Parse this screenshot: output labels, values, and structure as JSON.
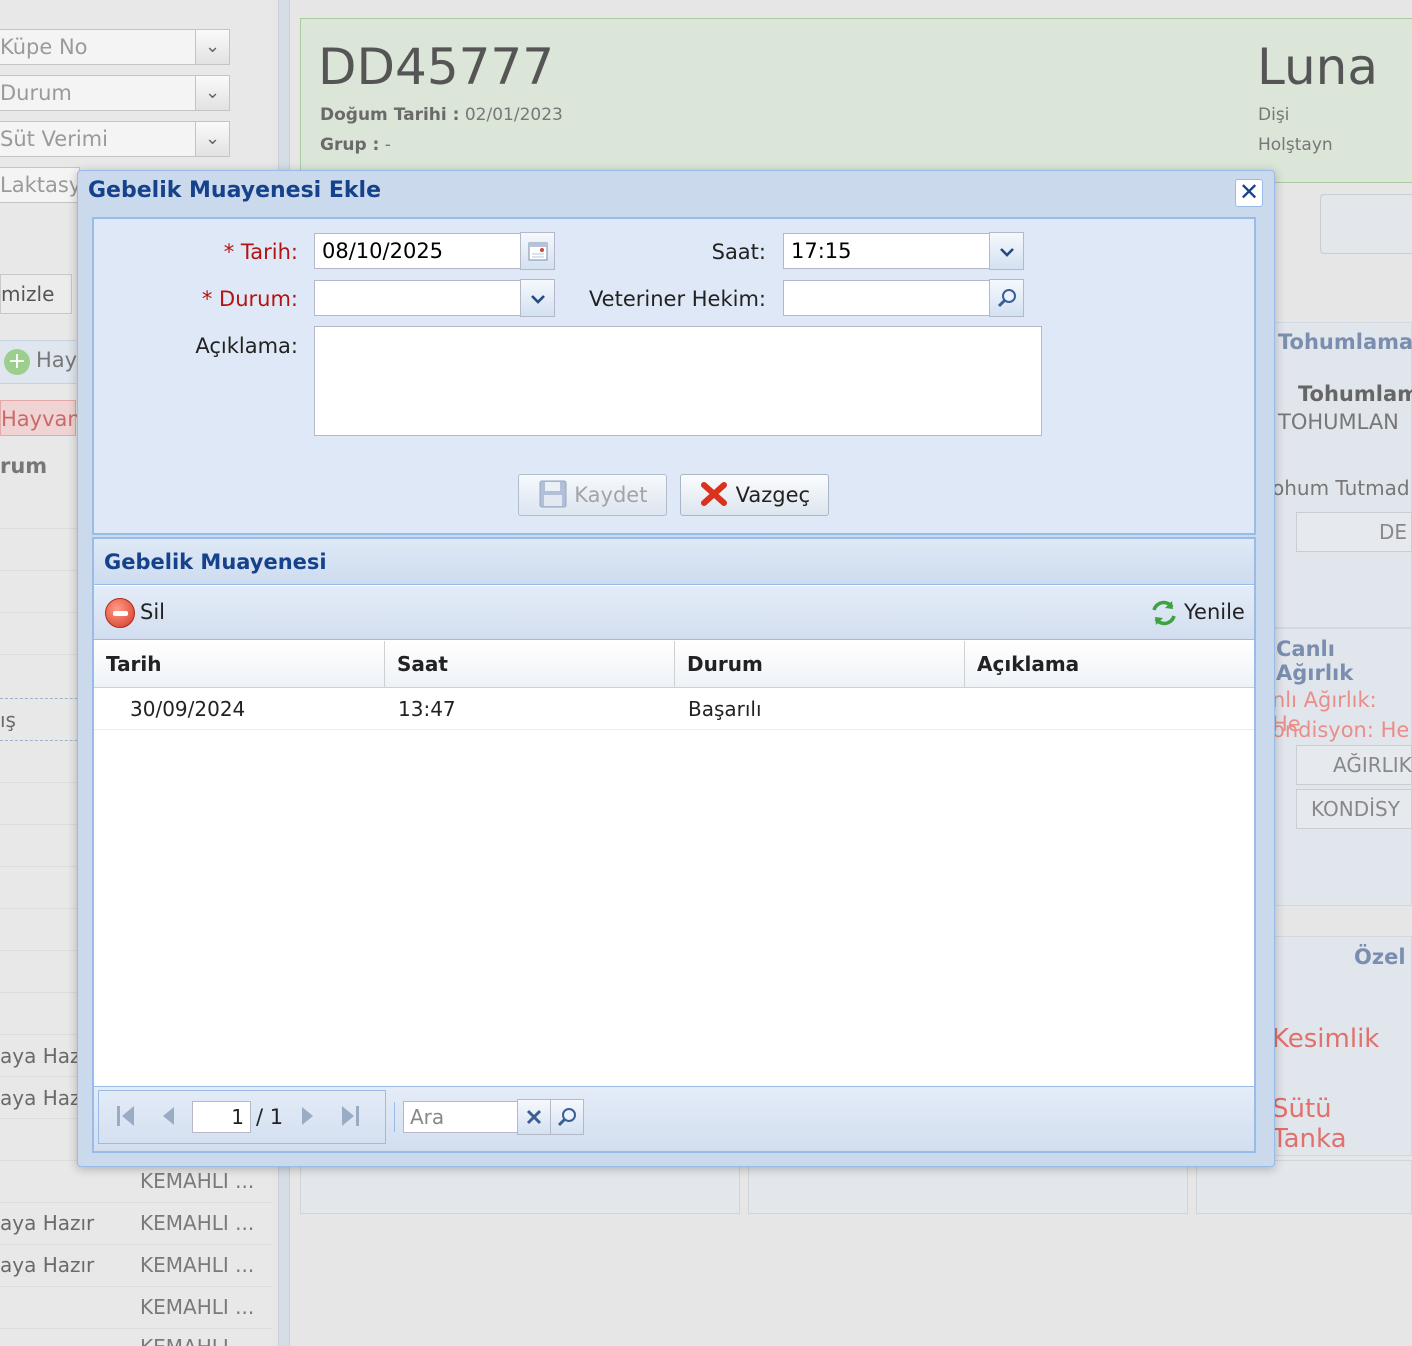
{
  "background": {
    "filters": [
      "Küpe No",
      "Durum",
      "Süt Verimi",
      "Laktasyon"
    ],
    "clear_button": "mizle",
    "add_animal_button": "Hay",
    "tab_animal": "Hayvan",
    "tab_status": "rum",
    "row_partial": "ış",
    "list_rows": [
      {
        "status": "aya Haz",
        "kem": ""
      },
      {
        "status": "aya Haz",
        "kem": ""
      },
      {
        "status": "",
        "kem": "KEMAHLI ..."
      },
      {
        "status": "aya Hazır",
        "kem": "KEMAHLI ..."
      },
      {
        "status": "aya Hazır",
        "kem": "KEMAHLI ..."
      },
      {
        "status": "",
        "kem": "KEMAHLI ..."
      },
      {
        "status": "",
        "kem": "KEMAHLI"
      }
    ],
    "header": {
      "ear_tag": "DD45777",
      "birth_label": "Doğum Tarihi :",
      "birth_value": "02/01/2023",
      "group_label": "Grup :",
      "group_value": "-",
      "name": "Luna",
      "sex": "Dişi",
      "breed": "Holştayn"
    },
    "right_column": {
      "insemination_title": "Tohumlama",
      "insemination_sub": "Tohumlam",
      "insemination_value": "TOHUMLAN",
      "insemination_status": "ohum Tutmad",
      "insemination_btn": "DE",
      "weight_title": "Canlı Ağırlık",
      "weight_line1": "nlı Ağırlık: He",
      "weight_line2": "ondisyon: He",
      "weight_btn": "AĞIRLIK",
      "condition_btn": "KONDİSY",
      "special_title": "Özel",
      "special_1": "Kesimlik",
      "special_2": "Sütü Tanka"
    }
  },
  "dialog": {
    "title": "Gebelik Muayenesi Ekle",
    "form": {
      "date_label": "* Tarih:",
      "date_value": "08/10/2025",
      "time_label": "Saat:",
      "time_value": "17:15",
      "status_label": "* Durum:",
      "status_value": "",
      "vet_label": "Veteriner Hekim:",
      "vet_value": "",
      "desc_label": "Açıklama:",
      "desc_value": "",
      "save_button": "Kaydet",
      "cancel_button": "Vazgeç"
    },
    "grid": {
      "title": "Gebelik Muayenesi",
      "delete_button": "Sil",
      "refresh_button": "Yenile",
      "columns": [
        "Tarih",
        "Saat",
        "Durum",
        "Açıklama"
      ],
      "rows": [
        {
          "date": "30/09/2024",
          "time": "13:47",
          "status": "Başarılı",
          "desc": ""
        }
      ],
      "paging": {
        "page": "1",
        "of_label": "/ 1",
        "search_placeholder": "Ara"
      }
    }
  },
  "colors": {
    "dialog_title": "#15428b",
    "required_label": "#b51212",
    "panel_border": "#99bbe8"
  }
}
